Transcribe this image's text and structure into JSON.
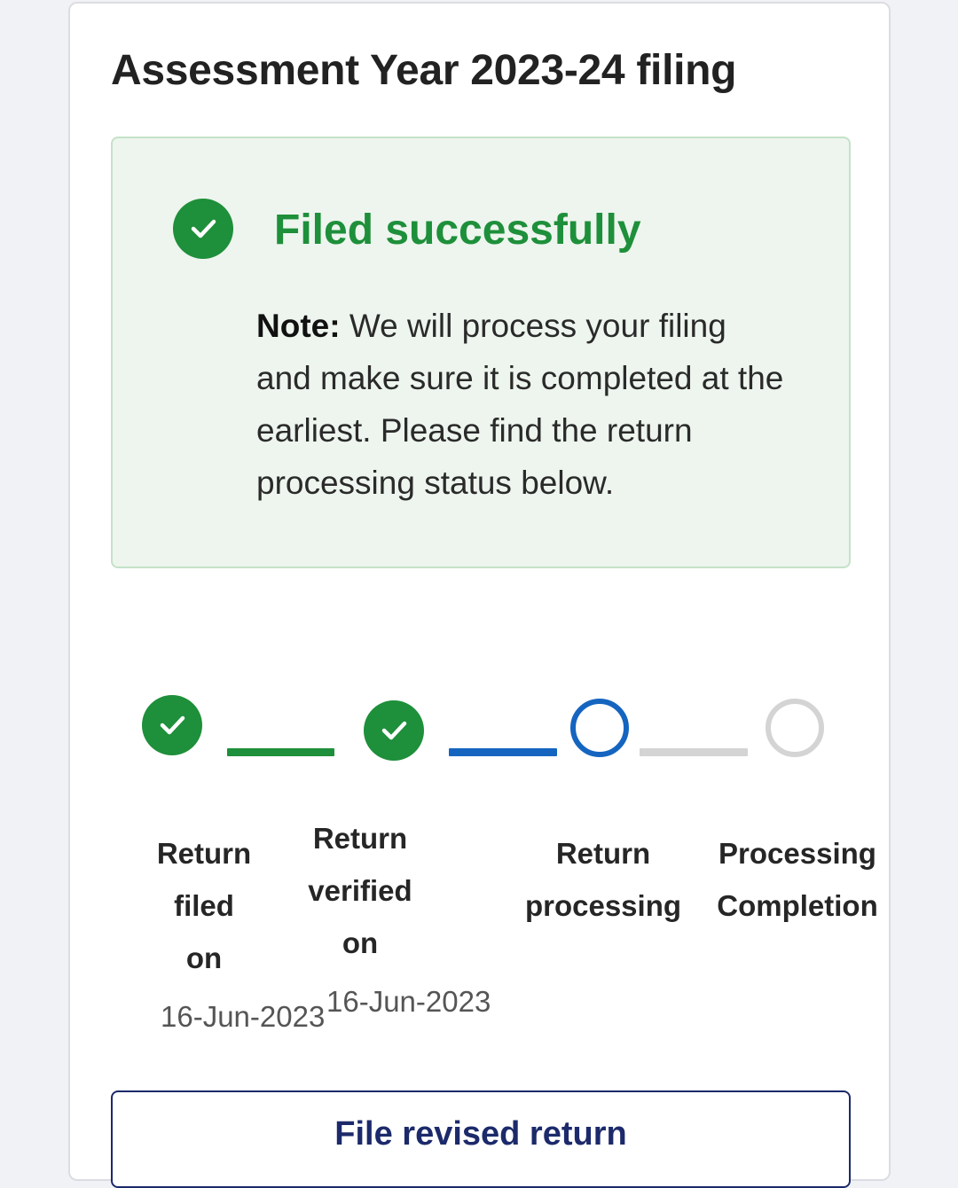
{
  "card": {
    "title": "Assessment Year 2023-24 filing"
  },
  "status_box": {
    "icon": "check-circle-icon",
    "title": "Filed successfully",
    "note_label": "Note:",
    "note_text": " We will process your filing and make sure it is completed at the earliest. Please find the return processing status below."
  },
  "stepper": {
    "steps": [
      {
        "label_lines": [
          "Return",
          "filed",
          "on"
        ],
        "date": "16-Jun-2023",
        "state": "completed",
        "icon": "check-circle-icon"
      },
      {
        "label_lines": [
          "Return",
          "verified",
          "on"
        ],
        "date": "16-Jun-2023",
        "state": "completed",
        "icon": "check-circle-icon"
      },
      {
        "label_lines": [
          "Return",
          "processing"
        ],
        "date": "",
        "state": "active",
        "icon": "circle-outline-icon"
      },
      {
        "label_lines": [
          "Processing",
          "Completion"
        ],
        "date": "",
        "state": "pending",
        "icon": "circle-outline-icon"
      }
    ]
  },
  "actions": {
    "file_revised_label": "File revised return"
  },
  "colors": {
    "success": "#1e8f3a",
    "active": "#1565c0",
    "pending": "#d4d4d4",
    "primary_text": "#1c2a6b"
  }
}
